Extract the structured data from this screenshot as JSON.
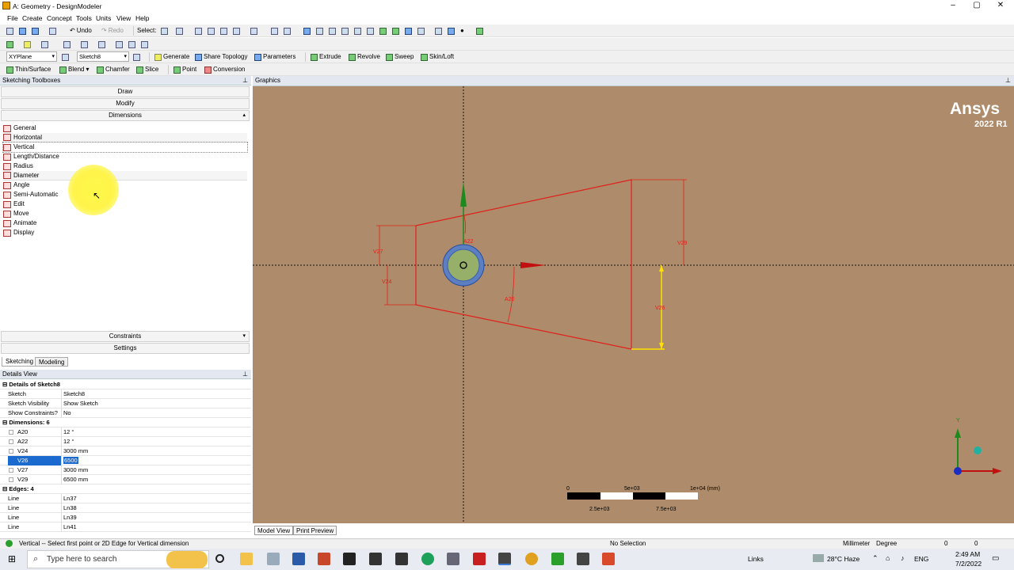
{
  "window": {
    "title": "A: Geometry - DesignModeler",
    "minimize": "–",
    "maximize": "▢",
    "close": "✕"
  },
  "menu": [
    "File",
    "Create",
    "Concept",
    "Tools",
    "Units",
    "View",
    "Help"
  ],
  "toolbar1": {
    "undo": "Undo",
    "redo": "Redo",
    "select": "Select:"
  },
  "toolbar3": {
    "plane": "XYPlane",
    "sketch": "Sketch8",
    "generate": "Generate",
    "share_topology": "Share Topology",
    "parameters": "Parameters",
    "extrude": "Extrude",
    "revolve": "Revolve",
    "sweep": "Sweep",
    "skin_loft": "Skin/Loft"
  },
  "toolbar4": {
    "thin_surface": "Thin/Surface",
    "blend": "Blend",
    "chamfer": "Chamfer",
    "slice": "Slice",
    "point": "Point",
    "conversion": "Conversion"
  },
  "sketching": {
    "header": "Sketching Toolboxes",
    "draw": "Draw",
    "modify": "Modify",
    "dimensions": "Dimensions",
    "tools": [
      "General",
      "Horizontal",
      "Vertical",
      "Length/Distance",
      "Radius",
      "Diameter",
      "Angle",
      "Semi-Automatic",
      "Edit",
      "Move",
      "Animate",
      "Display"
    ],
    "constraints": "Constraints",
    "settings": "Settings"
  },
  "tabs": {
    "sketching": "Sketching",
    "modeling": "Modeling"
  },
  "details": {
    "header": "Details View",
    "group1": "Details of Sketch8",
    "rows1": [
      [
        "Sketch",
        "Sketch8"
      ],
      [
        "Sketch Visibility",
        "Show Sketch"
      ],
      [
        "Show Constraints?",
        "No"
      ]
    ],
    "group2": "Dimensions: 6",
    "dims": [
      [
        "A20",
        "12 °"
      ],
      [
        "A22",
        "12 °"
      ],
      [
        "V24",
        "3000 mm"
      ],
      [
        "V26",
        "6500"
      ],
      [
        "V27",
        "3000 mm"
      ],
      [
        "V29",
        "6500 mm"
      ]
    ],
    "group3": "Edges: 4",
    "edges": [
      [
        "Line",
        "Ln37"
      ],
      [
        "Line",
        "Ln38"
      ],
      [
        "Line",
        "Ln39"
      ],
      [
        "Line",
        "Ln41"
      ]
    ]
  },
  "graphics": {
    "header": "Graphics",
    "brand": "Ansys",
    "version": "2022 R1",
    "dim_labels": {
      "v27": "V27",
      "v24": "V24",
      "a22": "A22",
      "a20": "A20",
      "v29": "V29",
      "v26": "V26"
    },
    "scale": {
      "t0": "0",
      "t1": "5e+03",
      "t2": "1e+04 (mm)",
      "t3": "2.5e+03",
      "t4": "7.5e+03"
    },
    "axis_y": "Y",
    "model_view": "Model View",
    "print_preview": "Print Preview"
  },
  "status": {
    "message": "Vertical -- Select first point or 2D Edge for Vertical dimension",
    "selection": "No Selection",
    "units_len": "Millimeter",
    "units_ang": "Degree",
    "v1": "0",
    "v2": "0"
  },
  "taskbar": {
    "search": "Type here to search",
    "links": "Links",
    "weather": "28°C Haze",
    "lang": "ENG",
    "time": "2:49 AM",
    "date": "7/2/2022"
  }
}
